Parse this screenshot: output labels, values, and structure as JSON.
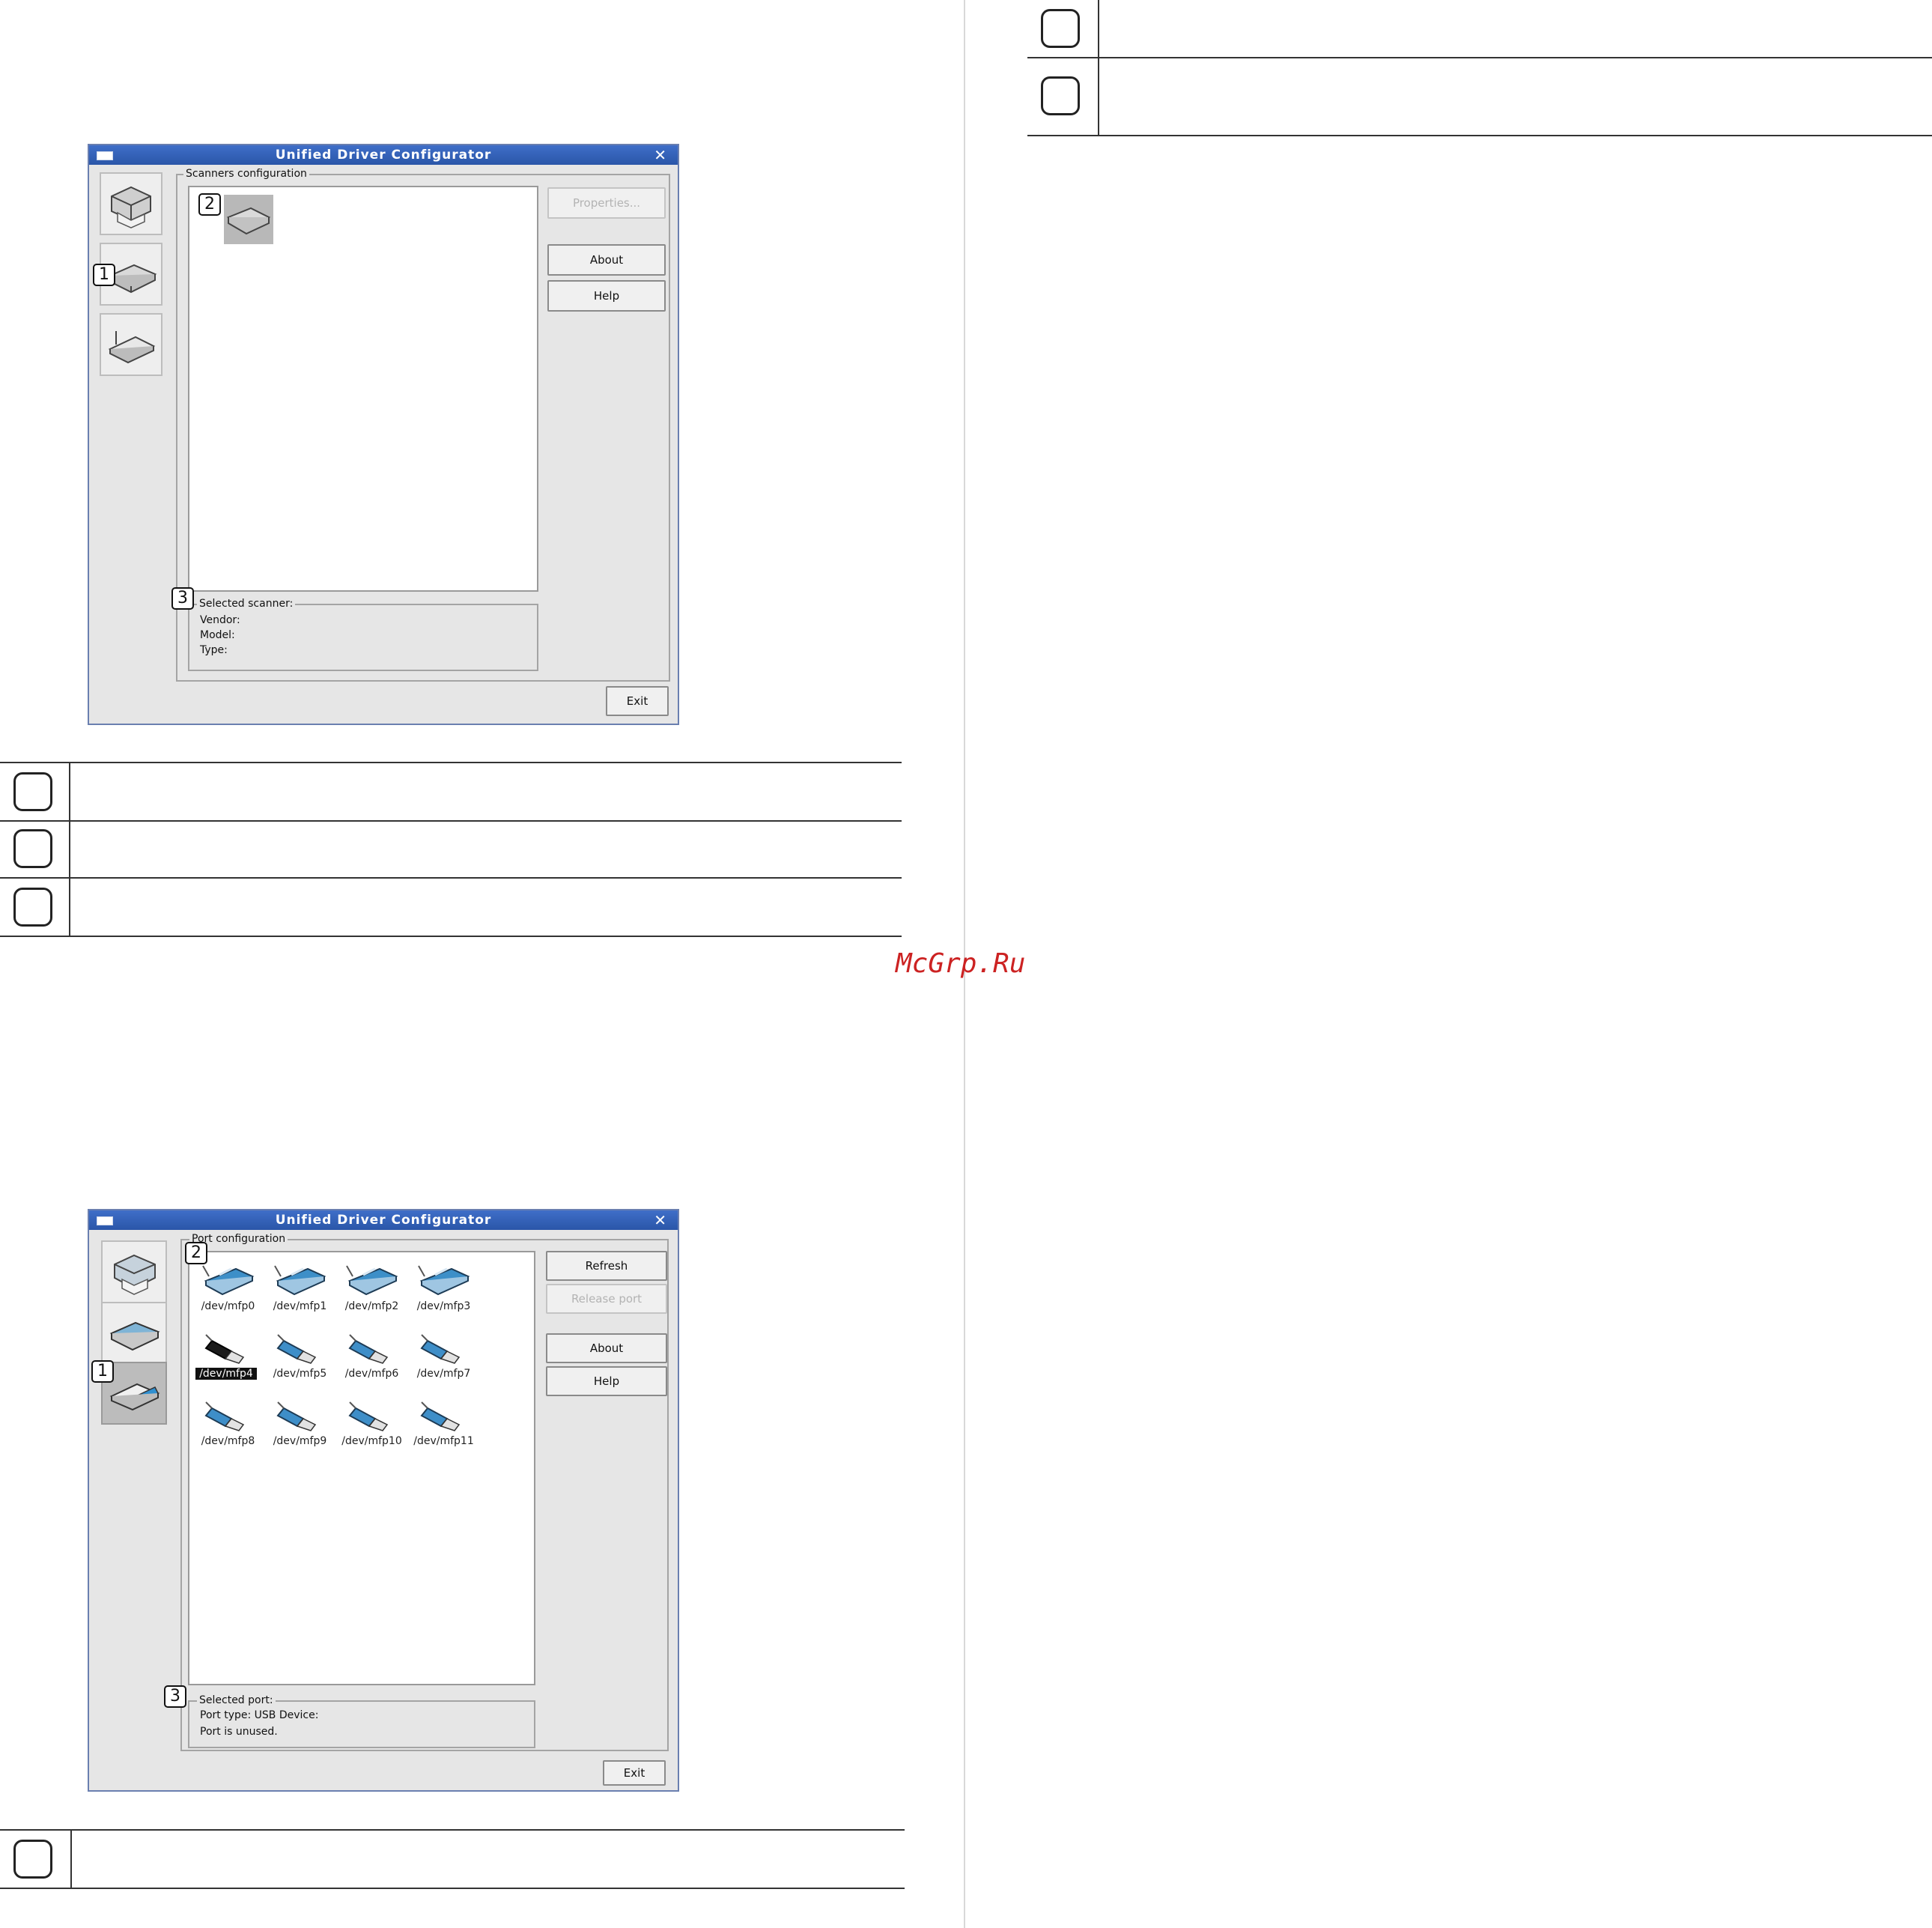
{
  "watermark": "McGrp.Ru",
  "window_title": "Unified Driver Configurator",
  "close_glyph": "✕",
  "scanner_window": {
    "group_label": "Scanners configuration",
    "properties_button": "Properties...",
    "about_button": "About",
    "help_button": "Help",
    "selected_label": "Selected scanner:",
    "vendor_label": "Vendor:",
    "model_label": "Model:",
    "type_label": "Type:",
    "exit_button": "Exit",
    "callouts": [
      "1",
      "2",
      "3"
    ]
  },
  "port_window": {
    "group_label": "Port configuration",
    "refresh_button": "Refresh",
    "release_button": "Release port",
    "about_button": "About",
    "help_button": "Help",
    "selected_label": "Selected port:",
    "port_type_line": "Port type: USB   Device:",
    "port_status_line": "Port is unused.",
    "exit_button": "Exit",
    "callouts": [
      "1",
      "2",
      "3"
    ],
    "ports": [
      {
        "label": "/dev/mfp0",
        "kind": "parallel"
      },
      {
        "label": "/dev/mfp1",
        "kind": "parallel"
      },
      {
        "label": "/dev/mfp2",
        "kind": "parallel"
      },
      {
        "label": "/dev/mfp3",
        "kind": "parallel"
      },
      {
        "label": "/dev/mfp4",
        "kind": "usb-selected"
      },
      {
        "label": "/dev/mfp5",
        "kind": "usb"
      },
      {
        "label": "/dev/mfp6",
        "kind": "usb"
      },
      {
        "label": "/dev/mfp7",
        "kind": "usb"
      },
      {
        "label": "/dev/mfp8",
        "kind": "usb"
      },
      {
        "label": "/dev/mfp9",
        "kind": "usb"
      },
      {
        "label": "/dev/mfp10",
        "kind": "usb"
      },
      {
        "label": "/dev/mfp11",
        "kind": "usb"
      }
    ]
  },
  "legend_top_right_rows": 2,
  "legend_scanner_rows": 3,
  "legend_port_rows": 1
}
